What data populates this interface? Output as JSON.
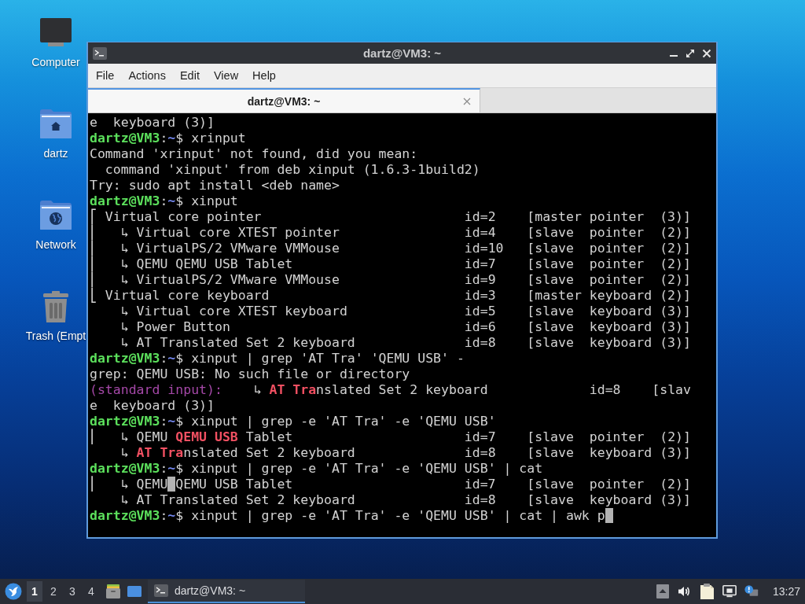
{
  "desktop_icons": [
    {
      "label": "Computer",
      "kind": "computer"
    },
    {
      "label": "dartz",
      "kind": "home"
    },
    {
      "label": "Network",
      "kind": "network"
    },
    {
      "label": "Trash (Empt",
      "kind": "trash"
    }
  ],
  "window": {
    "title": "dartz@VM3: ~",
    "menu": [
      "File",
      "Actions",
      "Edit",
      "View",
      "Help"
    ],
    "tabs": [
      {
        "label": "dartz@VM3: ~",
        "selected": true
      }
    ],
    "terminal": {
      "lines": [
        {
          "text": "e  keyboard (3)]"
        },
        {
          "segments": [
            {
              "kind": "user",
              "text": "dartz@VM3"
            },
            {
              "kind": "text",
              "text": ":"
            },
            {
              "kind": "path",
              "text": "~"
            },
            {
              "kind": "text",
              "text": "$ xrinput"
            }
          ]
        },
        {
          "text": "Command 'xrinput' not found, did you mean:"
        },
        {
          "text": "  command 'xinput' from deb xinput (1.6.3-1build2)"
        },
        {
          "text": "Try: sudo apt install <deb name>"
        },
        {
          "segments": [
            {
              "kind": "user",
              "text": "dartz@VM3"
            },
            {
              "kind": "text",
              "text": ":"
            },
            {
              "kind": "path",
              "text": "~"
            },
            {
              "kind": "text",
              "text": "$ xinput"
            }
          ]
        },
        {
          "text": "⎡ Virtual core pointer                          id=2    [master pointer  (3)]"
        },
        {
          "text": "⎜   ↳ Virtual core XTEST pointer                id=4    [slave  pointer  (2)]"
        },
        {
          "text": "⎜   ↳ VirtualPS/2 VMware VMMouse                id=10   [slave  pointer  (2)]"
        },
        {
          "text": "⎜   ↳ QEMU QEMU USB Tablet                      id=7    [slave  pointer  (2)]"
        },
        {
          "text": "⎜   ↳ VirtualPS/2 VMware VMMouse                id=9    [slave  pointer  (2)]"
        },
        {
          "text": "⎣ Virtual core keyboard                         id=3    [master keyboard (2)]"
        },
        {
          "text": "    ↳ Virtual core XTEST keyboard               id=5    [slave  keyboard (3)]"
        },
        {
          "text": "    ↳ Power Button                              id=6    [slave  keyboard (3)]"
        },
        {
          "text": "    ↳ AT Translated Set 2 keyboard              id=8    [slave  keyboard (3)]"
        },
        {
          "segments": [
            {
              "kind": "user",
              "text": "dartz@VM3"
            },
            {
              "kind": "text",
              "text": ":"
            },
            {
              "kind": "path",
              "text": "~"
            },
            {
              "kind": "text",
              "text": "$ xinput | grep 'AT Tra' 'QEMU USB' -"
            }
          ]
        },
        {
          "text": "grep: QEMU USB: No such file or directory"
        },
        {
          "segments": [
            {
              "kind": "label",
              "text": "(standard input):"
            },
            {
              "kind": "text",
              "text": "    ↳ "
            },
            {
              "kind": "match",
              "text": "AT Tra"
            },
            {
              "kind": "text",
              "text": "nslated Set 2 keyboard             id=8    [slav"
            }
          ]
        },
        {
          "text": "e  keyboard (3)]"
        },
        {
          "segments": [
            {
              "kind": "user",
              "text": "dartz@VM3"
            },
            {
              "kind": "text",
              "text": ":"
            },
            {
              "kind": "path",
              "text": "~"
            },
            {
              "kind": "text",
              "text": "$ xinput | grep -e 'AT Tra' -e 'QEMU USB'"
            }
          ]
        },
        {
          "segments": [
            {
              "kind": "text",
              "text": "⎜   ↳ QEMU "
            },
            {
              "kind": "match",
              "text": "QEMU USB"
            },
            {
              "kind": "text",
              "text": " Tablet                      id=7    [slave  pointer  (2)]"
            }
          ]
        },
        {
          "segments": [
            {
              "kind": "text",
              "text": "    ↳ "
            },
            {
              "kind": "match",
              "text": "AT Tra"
            },
            {
              "kind": "text",
              "text": "nslated Set 2 keyboard              id=8    [slave  keyboard (3)]"
            }
          ]
        },
        {
          "segments": [
            {
              "kind": "user",
              "text": "dartz@VM3"
            },
            {
              "kind": "text",
              "text": ":"
            },
            {
              "kind": "path",
              "text": "~"
            },
            {
              "kind": "text",
              "text": "$ xinput | grep -e 'AT Tra' -e 'QEMU USB' | cat"
            }
          ]
        },
        {
          "segments": [
            {
              "kind": "text",
              "text": "⎜   ↳ QEMU"
            },
            {
              "kind": "cursor"
            },
            {
              "kind": "text",
              "text": "QEMU USB Tablet                      id=7    [slave  pointer  (2)]"
            }
          ]
        },
        {
          "text": "    ↳ AT Translated Set 2 keyboard              id=8    [slave  keyboard (3)]"
        },
        {
          "segments": [
            {
              "kind": "user",
              "text": "dartz@VM3"
            },
            {
              "kind": "text",
              "text": ":"
            },
            {
              "kind": "path",
              "text": "~"
            },
            {
              "kind": "text",
              "text": "$ xinput | grep -e 'AT Tra' -e 'QEMU USB' | cat | awk p"
            },
            {
              "kind": "cursor"
            }
          ]
        }
      ]
    }
  },
  "taskbar": {
    "workspaces": [
      {
        "label": "1",
        "selected": true
      },
      {
        "label": "2",
        "selected": false
      },
      {
        "label": "3",
        "selected": false
      },
      {
        "label": "4",
        "selected": false
      }
    ],
    "tasks": [
      {
        "label": "dartz@VM3: ~",
        "active": true
      }
    ],
    "clock": "13:27"
  }
}
